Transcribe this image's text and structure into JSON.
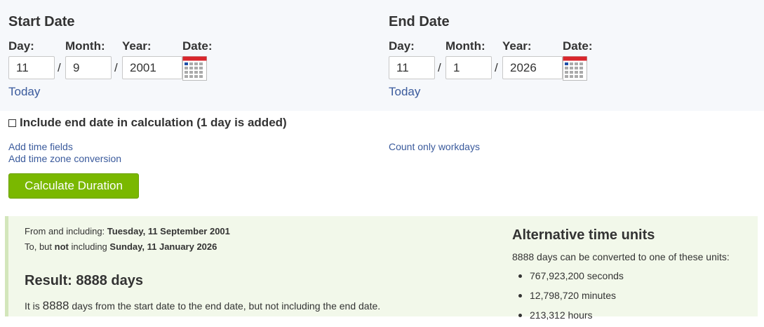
{
  "start": {
    "title": "Start Date",
    "labels": {
      "day": "Day:",
      "month": "Month:",
      "year": "Year:",
      "date": "Date:"
    },
    "day": "11",
    "month": "9",
    "year": "2001",
    "today": "Today"
  },
  "end": {
    "title": "End Date",
    "labels": {
      "day": "Day:",
      "month": "Month:",
      "year": "Year:",
      "date": "Date:"
    },
    "day": "11",
    "month": "1",
    "year": "2026",
    "today": "Today"
  },
  "separator": "/",
  "include_end_label": "Include end date in calculation (1 day is added)",
  "links": {
    "add_time_fields": "Add time fields",
    "add_timezone": "Add time zone conversion",
    "count_workdays": "Count only workdays"
  },
  "calculate_button": "Calculate Duration",
  "result": {
    "from_prefix": "From and including: ",
    "from_date": "Tuesday, 11 September 2001",
    "to_prefix1": "To, but ",
    "to_not": "not",
    "to_prefix2": " including ",
    "to_date": "Sunday, 11 January 2026",
    "title": "Result: 8888 days",
    "text_prefix": "It is ",
    "text_number": "8888",
    "text_suffix": " days from the start date to the end date, but not including the end date."
  },
  "alternative": {
    "title": "Alternative time units",
    "intro": "8888 days can be converted to one of these units:",
    "units": [
      "767,923,200 seconds",
      "12,798,720 minutes",
      "213,312 hours"
    ]
  },
  "colors": {
    "accent_green": "#7ab800",
    "link_blue": "#3a5a9c",
    "result_bg": "#f2f8ea"
  },
  "icons": {
    "calendar": "calendar-icon"
  }
}
